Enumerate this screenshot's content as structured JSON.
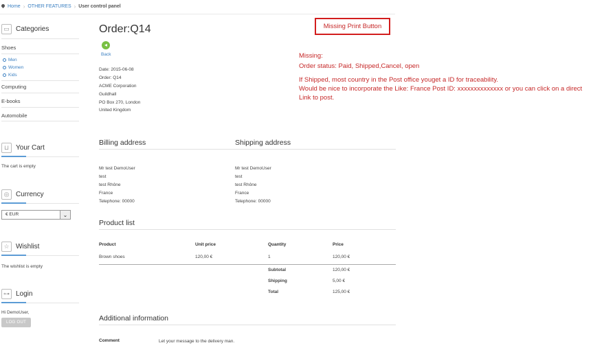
{
  "breadcrumb": {
    "home": "Home",
    "section": "OTHER FEATURES",
    "current": "User control panel"
  },
  "sidebar": {
    "categories": {
      "title": "Categories",
      "items": [
        "Shoes",
        "Computing",
        "E-books",
        "Automobile"
      ],
      "shoes_sub": [
        "Men",
        "Women",
        "Kids"
      ]
    },
    "cart": {
      "title": "Your Cart",
      "empty_text": "The cart is empty"
    },
    "currency": {
      "title": "Currency",
      "selected": "€ EUR"
    },
    "wishlist": {
      "title": "Wishlist",
      "empty_text": "The wishlist is empty"
    },
    "login": {
      "title": "Login",
      "greeting": "Hi DemoUser,",
      "logout_label": "LOG OUT"
    }
  },
  "order": {
    "title": "Order:Q14",
    "back_label": "Back",
    "info": [
      "Date: 2015-06-08",
      "Order: Q14",
      "ACME Corporation",
      "Guildhall",
      "PO Box 270, London",
      "United Kingdom"
    ]
  },
  "billing": {
    "title": "Billing address",
    "lines": [
      "Mr test DemoUser",
      "test",
      "test Rhône",
      "France",
      "Telephone: 00000"
    ]
  },
  "shipping": {
    "title": "Shipping address",
    "lines": [
      "Mr test DemoUser",
      "test",
      "test Rhône",
      "France",
      "Telephone: 00000"
    ]
  },
  "products": {
    "title": "Product list",
    "headers": [
      "Product",
      "Unit price",
      "Quantity",
      "Price"
    ],
    "rows": [
      {
        "product": "Brown shoes",
        "unit_price": "120,00 €",
        "quantity": "1",
        "price": "120,00 €"
      }
    ],
    "totals": [
      {
        "label": "Subtotal",
        "value": "120,00 €"
      },
      {
        "label": "Shipping",
        "value": "5,00 €"
      },
      {
        "label": "Total",
        "value": "125,00 €"
      }
    ]
  },
  "additional": {
    "title": "Additional information",
    "comment_label": "Comment",
    "comment_value": "Let your message to the delivery man."
  },
  "annotations": {
    "missing_print": "Missing Print Button",
    "lines": [
      "Missing:",
      "Order status: Paid, Shipped,Cancel, open",
      "If Shipped, most country in the Post office youget a ID for traceability.",
      "Would be nice to incorporate the Like: France Post ID: xxxxxxxxxxxxxx or you can click on a direct",
      "Link to post."
    ],
    "color": "#c62828"
  },
  "colors": {
    "link": "#3a7fc1",
    "accent": "#5b9bd5",
    "back_icon": "#79c043"
  }
}
